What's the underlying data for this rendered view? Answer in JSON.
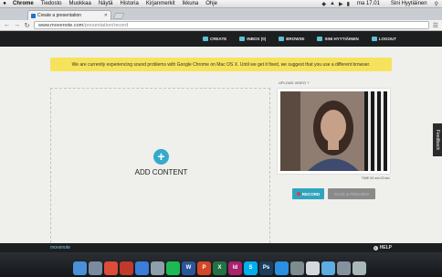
{
  "menubar": {
    "apple_glyph": "",
    "items": [
      "Chrome",
      "Tiedosto",
      "Muokkaa",
      "Näytä",
      "Historia",
      "Kirjanmerkit",
      "Ikkuna",
      "Ohje"
    ],
    "clock": "ma 17.01",
    "user": "Sini Hyytiäinen"
  },
  "browser": {
    "tab_title": "Create a presentation",
    "url_domain": "www.movenote.com",
    "url_path": "/presentation/record"
  },
  "site_nav": {
    "items": [
      {
        "label": "CREATE",
        "icon": "create-icon"
      },
      {
        "label": "INBOX (0)",
        "icon": "inbox-icon"
      },
      {
        "label": "BROWSE",
        "icon": "browse-icon"
      },
      {
        "label": "SINI HYYTIÄINEN",
        "icon": "user-icon"
      },
      {
        "label": "LOGOUT",
        "icon": "logout-icon"
      }
    ]
  },
  "content": {
    "warning": "We are currently experiencing sound problems with Google Chrome on Mac OS X. Until we get it fixed, we suggest that you use a different browser.",
    "add_content_label": "ADD CONTENT",
    "upload_video_label": "UPLOAD VIDEO",
    "time_label": "TIME 00 min 00 sec",
    "record_label": "RECORD",
    "save_label": "SAVE & PREVIEW",
    "feedback_label": "Feedback"
  },
  "footer": {
    "logo": "movenote",
    "help_label": "HELP"
  },
  "dock_apps": [
    {
      "name": "finder-icon",
      "color": "#4a90d9",
      "glyph": ""
    },
    {
      "name": "launchpad-icon",
      "color": "#7a8aa0",
      "glyph": ""
    },
    {
      "name": "chrome-icon",
      "color": "#dd4b39",
      "glyph": ""
    },
    {
      "name": "photos-icon",
      "color": "#c0392b",
      "glyph": ""
    },
    {
      "name": "mail-icon",
      "color": "#3b7dd8",
      "glyph": ""
    },
    {
      "name": "preview-icon",
      "color": "#8e9eab",
      "glyph": ""
    },
    {
      "name": "spotify-icon",
      "color": "#1db954",
      "glyph": ""
    },
    {
      "name": "word-icon",
      "color": "#2b579a",
      "glyph": "W"
    },
    {
      "name": "powerpoint-icon",
      "color": "#d24726",
      "glyph": "P"
    },
    {
      "name": "excel-icon",
      "color": "#217346",
      "glyph": "X"
    },
    {
      "name": "indesign-icon",
      "color": "#a8226d",
      "glyph": "Id"
    },
    {
      "name": "skype-icon",
      "color": "#00aff0",
      "glyph": "S"
    },
    {
      "name": "photoshop-icon",
      "color": "#1a3e5c",
      "glyph": "Ps"
    },
    {
      "name": "itunes-icon",
      "color": "#2a8fe0",
      "glyph": ""
    },
    {
      "name": "systemprefs-icon",
      "color": "#7f8c8d",
      "glyph": ""
    },
    {
      "name": "document-icon",
      "color": "#d5d8dc",
      "glyph": ""
    },
    {
      "name": "folder-icon",
      "color": "#5dade2",
      "glyph": ""
    },
    {
      "name": "downloads-icon",
      "color": "#85929e",
      "glyph": ""
    },
    {
      "name": "trash-icon",
      "color": "#aab7b8",
      "glyph": ""
    }
  ]
}
